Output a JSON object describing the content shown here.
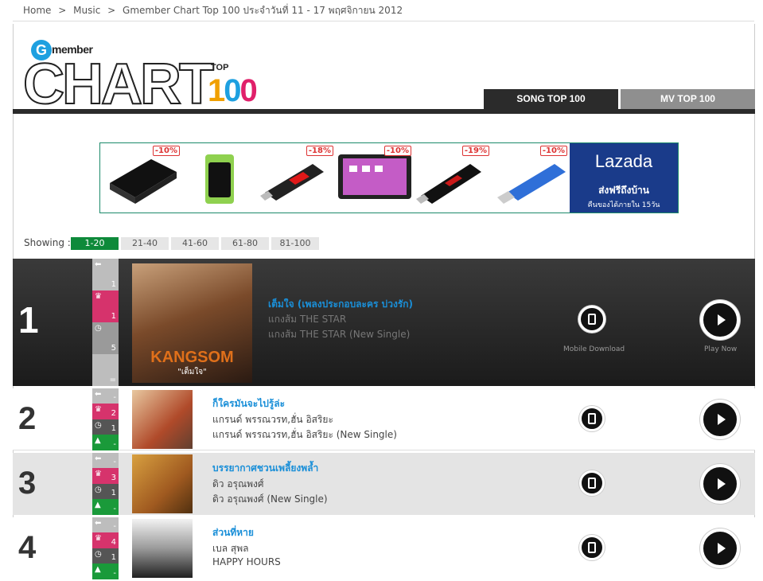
{
  "breadcrumb": {
    "home": "Home",
    "sep": ">",
    "music": "Music",
    "current": "Gmember Chart Top 100 ประจำวันที่ 11 - 17 พฤศจิกายน 2012"
  },
  "logo": {
    "g": "G",
    "member": "member",
    "chart": "CHART",
    "top": "TOP",
    "d1": "1",
    "d2": "0",
    "d3": "0"
  },
  "tabs": {
    "song": "SONG TOP 100",
    "mv": "MV TOP 100"
  },
  "banner": {
    "discounts": [
      "-10%",
      "",
      "-18%",
      "-10%",
      "-19%",
      "-10%"
    ],
    "brand": "Lazada",
    "line1": "ส่งฟรีถึงบ้าน",
    "line2": "คืนของได้ภายใน 15วัน",
    "colors": {
      "brand_bg": "#1a3b8a",
      "discount": "#dd3333"
    }
  },
  "pagination": {
    "label": "Showing :",
    "pages": [
      "1-20",
      "21-40",
      "41-60",
      "61-80",
      "81-100"
    ],
    "active": "1-20"
  },
  "captions": {
    "mobile": "Mobile Download",
    "play": "Play Now"
  },
  "songs": [
    {
      "rank": "1",
      "stats": [
        {
          "icon": "arrow-left-icon",
          "glyph": "⬅",
          "value": "1"
        },
        {
          "icon": "crown-icon",
          "glyph": "♛",
          "value": "1"
        },
        {
          "icon": "clock-icon",
          "glyph": "◷",
          "value": "5"
        },
        {
          "icon": "equal-icon",
          "glyph": "",
          "value": "="
        }
      ],
      "cover_text": "KANGSOM",
      "cover_sub": "\"เต็มใจ\"",
      "title": "เต็มใจ (เพลงประกอบละคร บ่วงรัก)",
      "artist": "แกงส้ม THE STAR",
      "album": "แกงส้ม THE STAR (New Single)"
    },
    {
      "rank": "2",
      "stats": [
        {
          "icon": "arrow-left-icon",
          "glyph": "⬅",
          "value": "-"
        },
        {
          "icon": "crown-icon",
          "glyph": "♛",
          "value": "2"
        },
        {
          "icon": "clock-icon",
          "glyph": "◷",
          "value": "1"
        },
        {
          "icon": "arrow-up-icon",
          "glyph": "▲",
          "value": "-"
        }
      ],
      "title": "ก็ใครมันจะไปรู้ล่ะ",
      "artist": "แกรนด์ พรรณวรท,ฮั่น อิสริยะ",
      "album": "แกรนด์ พรรณวรท,ฮั่น อิสริยะ (New Single)"
    },
    {
      "rank": "3",
      "stats": [
        {
          "icon": "arrow-left-icon",
          "glyph": "⬅",
          "value": "-"
        },
        {
          "icon": "crown-icon",
          "glyph": "♛",
          "value": "3"
        },
        {
          "icon": "clock-icon",
          "glyph": "◷",
          "value": "1"
        },
        {
          "icon": "arrow-up-icon",
          "glyph": "▲",
          "value": "-"
        }
      ],
      "title": "บรรยากาศชวนเพลี้ยงพล้ำ",
      "artist": "ดิว อรุณพงศ์",
      "album": "ดิว อรุณพงศ์ (New Single)"
    },
    {
      "rank": "4",
      "stats": [
        {
          "icon": "arrow-left-icon",
          "glyph": "⬅",
          "value": "-"
        },
        {
          "icon": "crown-icon",
          "glyph": "♛",
          "value": "4"
        },
        {
          "icon": "clock-icon",
          "glyph": "◷",
          "value": "1"
        },
        {
          "icon": "arrow-up-icon",
          "glyph": "▲",
          "value": "-"
        }
      ],
      "title": "ส่วนที่หาย",
      "artist": "เบล สุพล",
      "album": "HAPPY HOURS"
    }
  ]
}
